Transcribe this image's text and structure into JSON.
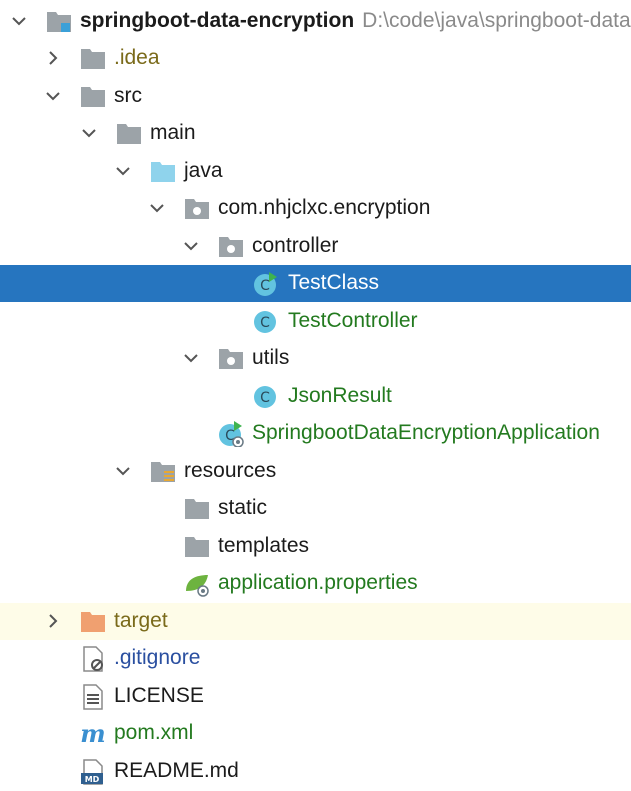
{
  "project": {
    "name": "springboot-data-encryption",
    "path": "D:\\code\\java\\springboot-data-encryption"
  },
  "tree": {
    "idea": ".idea",
    "src": "src",
    "main": "main",
    "java": "java",
    "package": "com.nhjclxc.encryption",
    "controller": "controller",
    "test_class": "TestClass",
    "test_controller": "TestController",
    "utils": "utils",
    "json_result": "JsonResult",
    "application_class": "SpringbootDataEncryptionApplication",
    "resources": "resources",
    "static": "static",
    "templates": "templates",
    "application_properties": "application.properties",
    "target": "target",
    "gitignore": ".gitignore",
    "license": "LICENSE",
    "pom": "pom.xml",
    "readme": "README.md"
  },
  "icons": {
    "chevron_right": "chevron-right-icon",
    "chevron_down": "chevron-down-icon",
    "module_folder": "module-folder-icon",
    "folder": "folder-icon",
    "source_folder": "source-folder-icon",
    "package": "package-icon",
    "class": "class-icon",
    "runnable_class": "runnable-class-icon",
    "spring_boot_app": "spring-boot-application-icon",
    "resources_folder": "resources-folder-icon",
    "spring_properties": "spring-properties-icon",
    "excluded_folder": "excluded-folder-icon",
    "ignore_file": "ignore-file-icon",
    "text_file": "text-file-icon",
    "maven_file": "maven-file-icon",
    "markdown_file": "markdown-file-icon"
  },
  "colors": {
    "selection": "#2675bf",
    "highlight": "#fefce8",
    "class_icon": "#62c3e0",
    "source_folder": "#8fd3ec",
    "excluded_folder": "#f0a070",
    "green_text": "#237a1f",
    "gray_text": "#8a8a8a"
  }
}
